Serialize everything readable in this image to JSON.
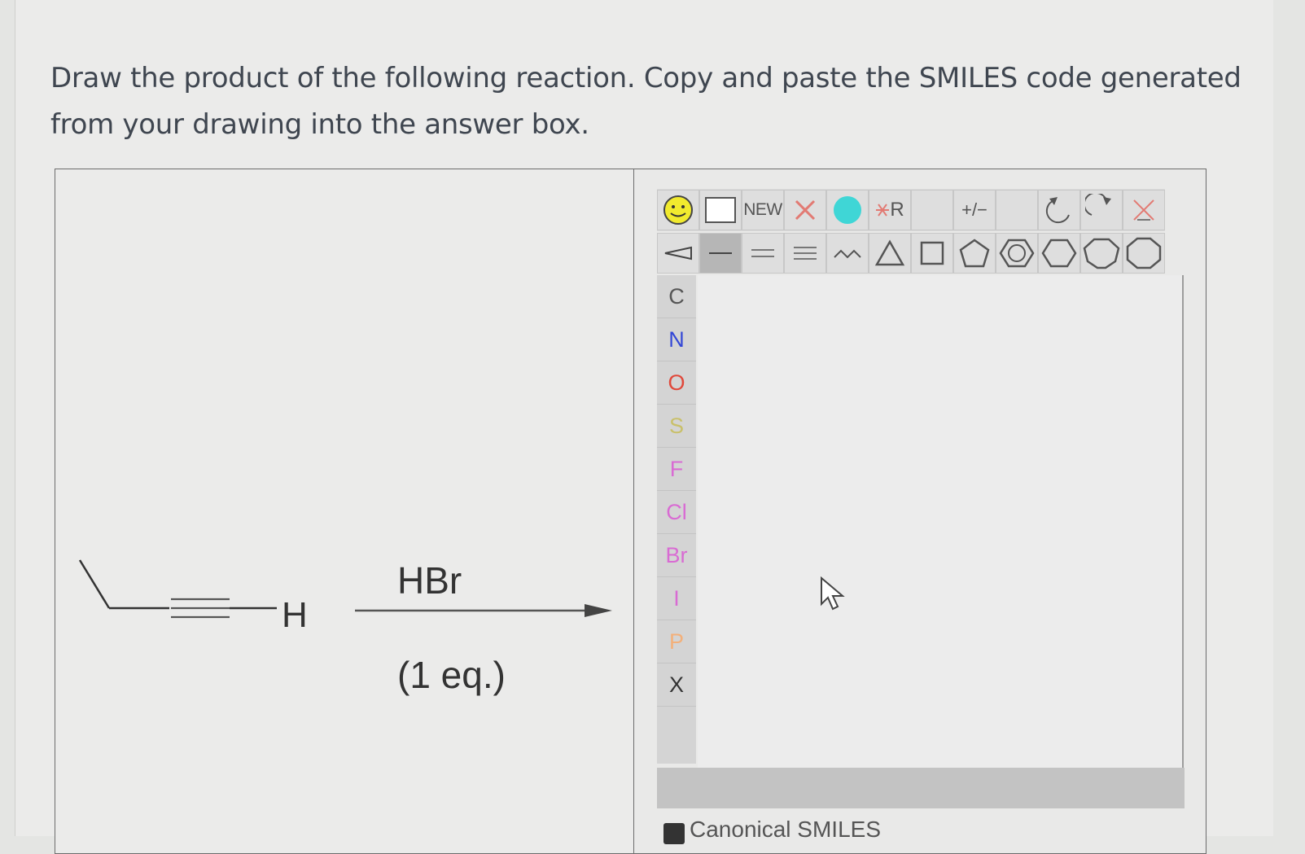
{
  "question": {
    "line1": "Draw the product of the following reaction. Copy and paste the SMILES code generated",
    "line2": "from your drawing into the answer box."
  },
  "reaction": {
    "terminal_atom": "H",
    "reagent": "HBr",
    "conditions": "(1 eq.)"
  },
  "editor": {
    "toolbar_row1": [
      {
        "icon": "smiley-icon"
      },
      {
        "icon": "blank-square-icon"
      },
      {
        "label": "NEW"
      },
      {
        "icon": "delete-x-icon"
      },
      {
        "icon": "cyan-circle-icon"
      },
      {
        "label": "R",
        "icon": "r-group-icon"
      },
      {
        "icon": "blank-icon"
      },
      {
        "label": "+/−",
        "icon": "charge-icon"
      },
      {
        "icon": "blank-icon"
      },
      {
        "icon": "undo-icon"
      },
      {
        "icon": "redo-icon"
      },
      {
        "icon": "clear-icon"
      }
    ],
    "toolbar_row2": [
      {
        "icon": "wedge-bond-icon"
      },
      {
        "icon": "single-bond-icon"
      },
      {
        "icon": "double-bond-icon"
      },
      {
        "icon": "triple-bond-icon"
      },
      {
        "icon": "chain-icon"
      },
      {
        "icon": "triangle-ring-icon"
      },
      {
        "icon": "square-ring-icon"
      },
      {
        "icon": "pentagon-ring-icon"
      },
      {
        "icon": "benzene-ring-icon"
      },
      {
        "icon": "hexagon-ring-icon"
      },
      {
        "icon": "heptagon-ring-icon"
      },
      {
        "icon": "octagon-ring-icon"
      }
    ],
    "atoms": [
      {
        "symbol": "C",
        "color": "#555555"
      },
      {
        "symbol": "N",
        "color": "#3347d6"
      },
      {
        "symbol": "O",
        "color": "#e0483a"
      },
      {
        "symbol": "S",
        "color": "#c9c06a"
      },
      {
        "symbol": "F",
        "color": "#d96bd3"
      },
      {
        "symbol": "Cl",
        "color": "#d96bd3"
      },
      {
        "symbol": "Br",
        "color": "#d96bd3"
      },
      {
        "symbol": "I",
        "color": "#d96bd3"
      },
      {
        "symbol": "P",
        "color": "#f3b07a"
      },
      {
        "symbol": "X",
        "color": "#333333"
      }
    ],
    "smiles_label": "Canonical SMILES"
  }
}
